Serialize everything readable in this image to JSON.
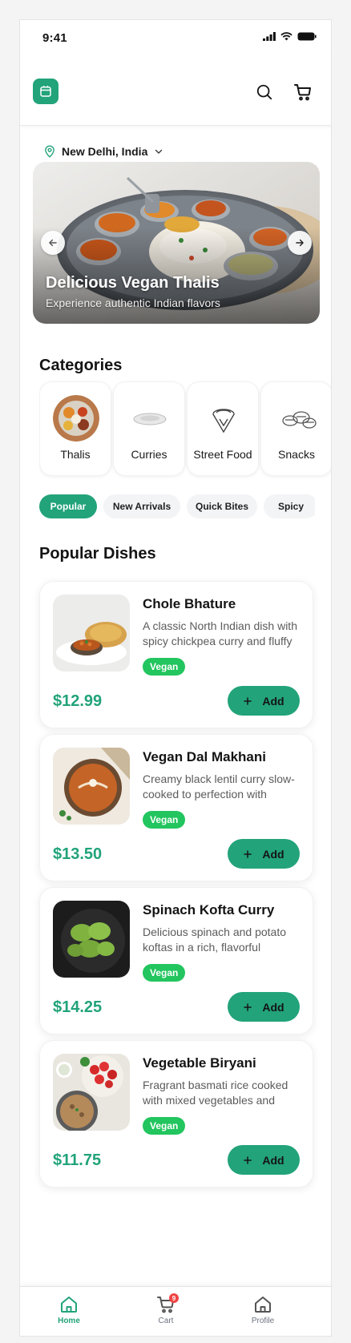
{
  "status_bar": {
    "time": "9:41"
  },
  "header": {
    "logo_icon": "store-icon",
    "search_icon": "search-icon",
    "cart_icon": "cart-icon"
  },
  "location": {
    "text": "New Delhi, India",
    "icon": "map-pin-icon"
  },
  "banner": {
    "title": "Delicious Vegan Thalis",
    "subtitle": "Experience authentic Indian flavors"
  },
  "categories": {
    "title": "Categories",
    "items": [
      {
        "label": "Thalis",
        "icon": "thali-plate-icon"
      },
      {
        "label": "Curries",
        "icon": "curry-bowl-icon"
      },
      {
        "label": "Street Food",
        "icon": "samosa-icon"
      },
      {
        "label": "Snacks",
        "icon": "snacks-icon"
      }
    ]
  },
  "filters": {
    "chips": [
      "Popular",
      "New Arrivals",
      "Quick Bites",
      "Spicy"
    ],
    "active": "Popular"
  },
  "popular": {
    "title": "Popular Dishes",
    "add_label": "Add",
    "dishes": [
      {
        "name": "Chole Bhature",
        "description": "A classic North Indian dish with spicy chickpea curry and fluffy",
        "tag": "Vegan",
        "price": "$12.99"
      },
      {
        "name": "Vegan Dal Makhani",
        "description": "Creamy black lentil curry slow-cooked to perfection with",
        "tag": "Vegan",
        "price": "$13.50"
      },
      {
        "name": "Spinach Kofta Curry",
        "description": "Delicious spinach and potato koftas in a rich, flavorful",
        "tag": "Vegan",
        "price": "$14.25"
      },
      {
        "name": "Vegetable Biryani",
        "description": "Fragrant basmati rice cooked with mixed vegetables and",
        "tag": "Vegan",
        "price": "$11.75"
      }
    ]
  },
  "bottom_nav": {
    "items": [
      {
        "label": "Home",
        "icon": "home-icon"
      },
      {
        "label": "Cart",
        "icon": "cart-icon"
      },
      {
        "label": "Profile",
        "icon": "profile-icon"
      }
    ],
    "active": "Home",
    "cart_count": "9"
  },
  "colors": {
    "accent": "#22a37a",
    "vegan_tag": "#22c55e",
    "badge": "#ef4444"
  }
}
